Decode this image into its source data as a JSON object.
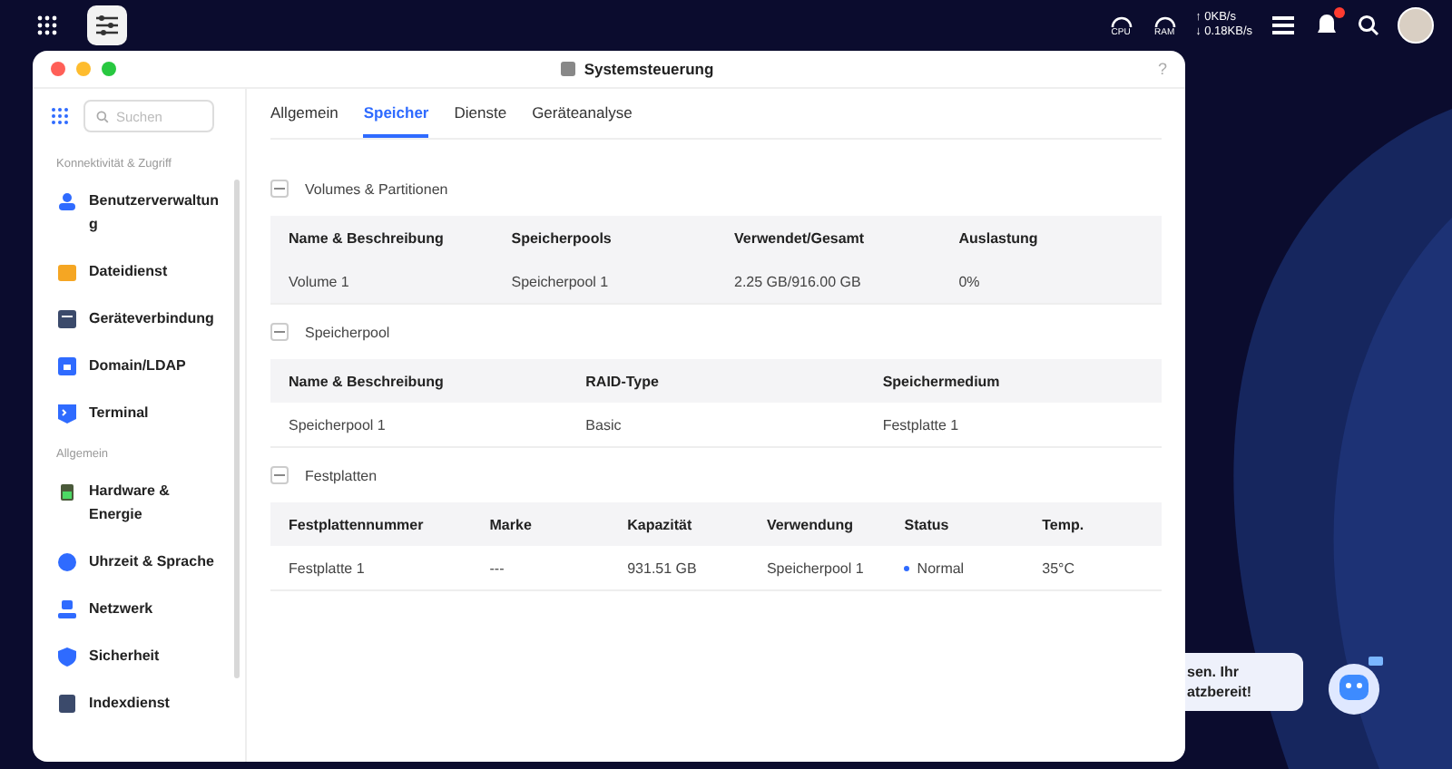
{
  "top_bar": {
    "cpu_label": "CPU",
    "ram_label": "RAM",
    "upload": "↑ 0KB/s",
    "download": "↓ 0.18KB/s",
    "notification_unread": true
  },
  "window": {
    "title": "Systemsteuerung",
    "help": "?"
  },
  "sidebar": {
    "search_placeholder": "Suchen",
    "groups": [
      {
        "title": "Konnektivität & Zugriff",
        "items": [
          {
            "label": "Benutzerverwaltung"
          },
          {
            "label": "Dateidienst"
          },
          {
            "label": "Geräteverbindung"
          },
          {
            "label": "Domain/LDAP"
          },
          {
            "label": "Terminal"
          }
        ]
      },
      {
        "title": "Allgemein",
        "items": [
          {
            "label": "Hardware & Energie"
          },
          {
            "label": "Uhrzeit & Sprache"
          },
          {
            "label": "Netzwerk"
          },
          {
            "label": "Sicherheit"
          },
          {
            "label": "Indexdienst"
          }
        ]
      }
    ]
  },
  "tabs": [
    {
      "label": "Allgemein",
      "selected": false
    },
    {
      "label": "Speicher",
      "selected": true
    },
    {
      "label": "Dienste",
      "selected": false
    },
    {
      "label": "Geräteanalyse",
      "selected": false
    }
  ],
  "sections": [
    {
      "title": "Volumes & Partitionen",
      "expanded": true,
      "columns": [
        "Name & Beschreibung",
        "Speicherpools",
        "Verwendet/Gesamt",
        "Auslastung"
      ],
      "rows": [
        {
          "selected": true,
          "cells": [
            "Volume 1",
            "Speicherpool 1",
            "2.25 GB/916.00 GB",
            "0%"
          ]
        }
      ]
    },
    {
      "title": "Speicherpool",
      "expanded": true,
      "columns": [
        "Name & Beschreibung",
        "RAID-Type",
        "Speichermedium"
      ],
      "rows": [
        {
          "selected": false,
          "cells": [
            "Speicherpool 1",
            "Basic",
            "Festplatte 1"
          ]
        }
      ]
    },
    {
      "title": "Festplatten",
      "expanded": true,
      "columns": [
        "Festplattennummer",
        "Marke",
        "Kapazität",
        "Verwendung",
        "Status",
        "Temp."
      ],
      "rows": [
        {
          "selected": false,
          "cells": [
            "Festplatte 1",
            "---",
            "931.51 GB",
            "Speicherpool 1",
            {
              "text": "Normal",
              "color": "#2f6bff"
            },
            "35°C"
          ]
        }
      ]
    }
  ],
  "assistant": {
    "lines": [
      "sen. Ihr",
      "atzbereit!"
    ]
  }
}
